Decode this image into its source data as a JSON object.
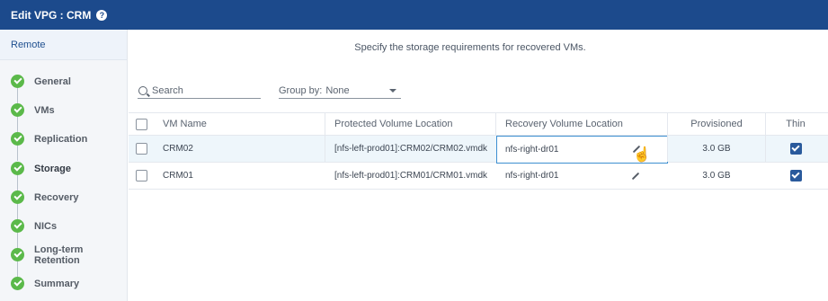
{
  "window": {
    "title": "Edit VPG : CRM",
    "help_icon": "question-circle-icon"
  },
  "sidebar": {
    "header": "Remote",
    "steps": [
      {
        "label": "General",
        "status": "complete"
      },
      {
        "label": "VMs",
        "status": "complete"
      },
      {
        "label": "Replication",
        "status": "complete"
      },
      {
        "label": "Storage",
        "status": "complete",
        "active": true
      },
      {
        "label": "Recovery",
        "status": "complete"
      },
      {
        "label": "NICs",
        "status": "complete"
      },
      {
        "label": "Long-term Retention",
        "status": "complete"
      },
      {
        "label": "Summary",
        "status": "complete"
      }
    ]
  },
  "main": {
    "instructions": "Specify the storage requirements for recovered VMs.",
    "search": {
      "placeholder": "Search"
    },
    "group_by": {
      "label": "Group by:",
      "value": "None"
    },
    "table": {
      "columns": [
        "VM Name",
        "Protected Volume Location",
        "Recovery Volume Location",
        "Provisioned",
        "Thin"
      ],
      "rows": [
        {
          "vm_name": "CRM02",
          "protected": "[nfs-left-prod01]:CRM02/CRM02.vmdk",
          "recovery": "nfs-right-dr01",
          "provisioned": "3.0 GB",
          "thin": true,
          "selected": true
        },
        {
          "vm_name": "CRM01",
          "protected": "[nfs-left-prod01]:CRM01/CRM01.vmdk",
          "recovery": "nfs-right-dr01",
          "provisioned": "3.0 GB",
          "thin": true,
          "selected": false
        }
      ]
    }
  },
  "colors": {
    "titlebar": "#1c4a8c",
    "check_complete": "#5bb94a",
    "checkbox_checked": "#2a5a9c",
    "edit_border": "#3d8fd1"
  }
}
